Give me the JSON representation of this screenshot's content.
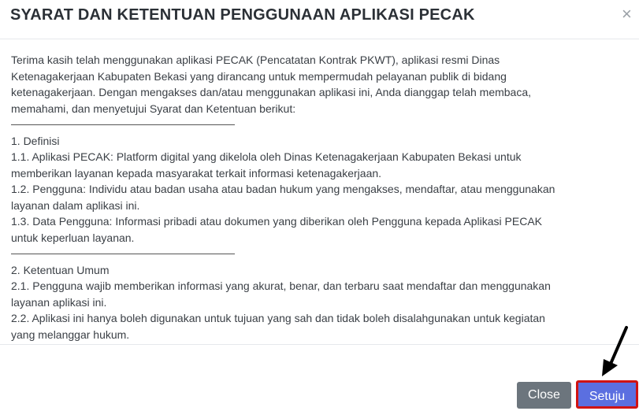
{
  "dialog": {
    "title": "SYARAT DAN KETENTUAN PENGGUNAAN APLIKASI PECAK",
    "close_glyph": "×"
  },
  "content": {
    "intro": [
      "Terima kasih telah menggunakan aplikasi PECAK (Pencatatan Kontrak PKWT), aplikasi resmi Dinas",
      "Ketenagakerjaan Kabupaten Bekasi yang dirancang untuk mempermudah pelayanan publik di bidang",
      "ketenagakerjaan. Dengan mengakses dan/atau menggunakan aplikasi ini, Anda dianggap telah membaca,",
      "memahami, dan menyetujui Syarat dan Ketentuan berikut:"
    ],
    "section1_title": "1. Definisi",
    "section1": [
      "1.1. Aplikasi PECAK: Platform digital yang dikelola oleh Dinas Ketenagakerjaan Kabupaten Bekasi untuk",
      "memberikan layanan kepada masyarakat terkait informasi ketenagakerjaan.",
      "1.2. Pengguna: Individu atau badan usaha atau badan hukum yang mengakses, mendaftar, atau menggunakan",
      "layanan dalam aplikasi ini.",
      "1.3. Data Pengguna: Informasi pribadi atau dokumen yang diberikan oleh Pengguna kepada Aplikasi PECAK",
      "untuk keperluan layanan."
    ],
    "section2_title": "2. Ketentuan Umum",
    "section2": [
      "2.1. Pengguna wajib memberikan informasi yang akurat, benar, dan terbaru saat mendaftar dan menggunakan",
      "layanan aplikasi ini.",
      "2.2. Aplikasi ini hanya boleh digunakan untuk tujuan yang sah dan tidak boleh disalahgunakan untuk kegiatan",
      "yang melanggar hukum."
    ]
  },
  "footer": {
    "close_label": "Close",
    "agree_label": "Setuju"
  },
  "colors": {
    "close_button": "#6c757d",
    "agree_button": "#5b6fe0",
    "highlight_border": "#d01313"
  }
}
